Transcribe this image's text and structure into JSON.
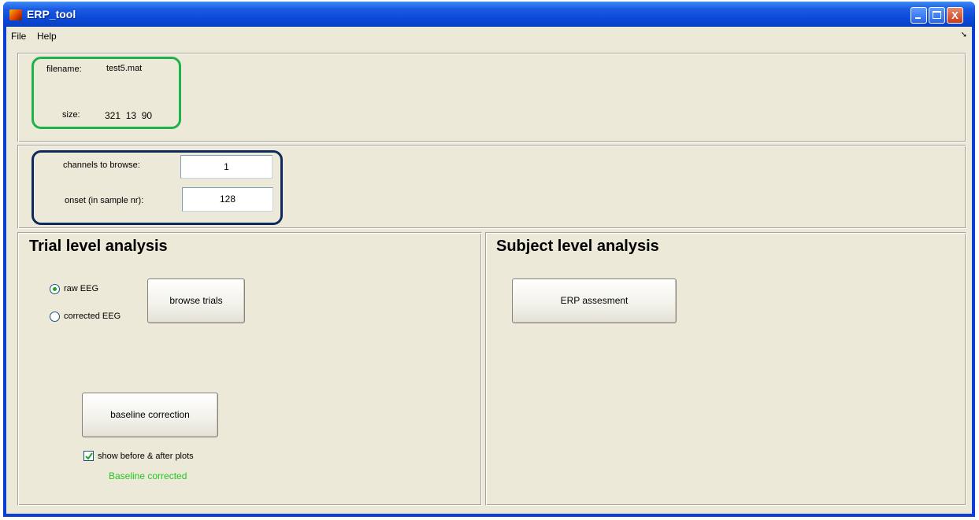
{
  "window": {
    "title": "ERP_tool",
    "buttons": {
      "minimize": "minimize",
      "maximize": "maximize",
      "close": "X"
    }
  },
  "menu": {
    "items": [
      "File",
      "Help"
    ],
    "overflow_icon": "arrow-icon"
  },
  "file_info": {
    "filename_label": "filename:",
    "filename_value": "test5.mat",
    "size_label": "size:",
    "size_value": "321  13  90"
  },
  "browse_settings": {
    "channels_label": "channels to browse:",
    "channels_value": "1",
    "onset_label": "onset (in sample nr):",
    "onset_value": "128"
  },
  "trial_panel": {
    "heading": "Trial level analysis",
    "radio_raw": "raw EEG",
    "radio_corrected": "corrected EEG",
    "selected_radio": "raw EEG",
    "browse_button": "browse trials",
    "baseline_button": "baseline correction",
    "checkbox_label": "show before & after plots",
    "checkbox_checked": true,
    "status_text": "Baseline corrected"
  },
  "subject_panel": {
    "heading": "Subject level analysis",
    "erp_button": "ERP assesment"
  },
  "colors": {
    "title_bar": "#0a48d6",
    "client_bg": "#ece9d8",
    "highlight_green": "#1fb14a",
    "highlight_navy": "#0e2a5c",
    "status_green": "#21c821"
  }
}
